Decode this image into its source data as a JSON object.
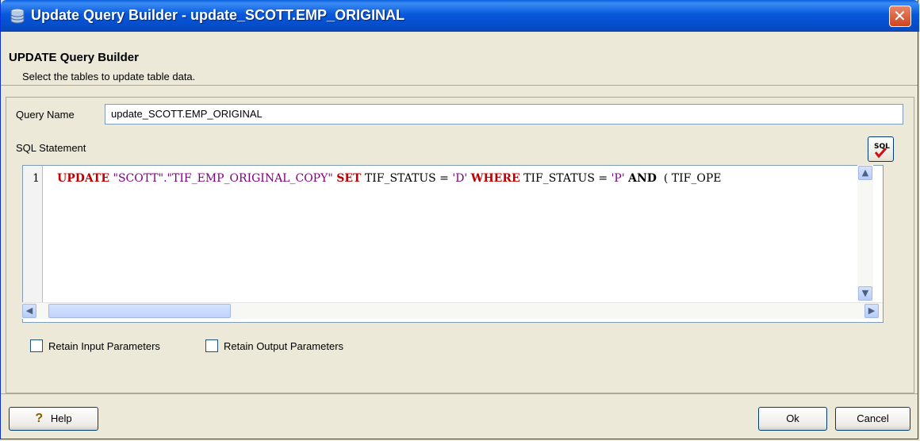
{
  "window": {
    "title": "Update Query Builder - update_SCOTT.EMP_ORIGINAL"
  },
  "header": {
    "title": "UPDATE Query Builder",
    "subtitle": "Select the tables to update table data."
  },
  "form": {
    "query_name_label": "Query Name",
    "query_name_value": "update_SCOTT.EMP_ORIGINAL",
    "sql_label": "SQL Statement",
    "sql_button_label": "SQL"
  },
  "editor": {
    "line_number": "1",
    "tokens": [
      {
        "text": "UPDATE",
        "cls": "kw"
      },
      {
        "text": " ",
        "cls": ""
      },
      {
        "text": "\"SCOTT\".\"TIF_EMP_ORIGINAL_COPY\"",
        "cls": "str"
      },
      {
        "text": " ",
        "cls": ""
      },
      {
        "text": "SET",
        "cls": "kw"
      },
      {
        "text": " TIF_STATUS = ",
        "cls": ""
      },
      {
        "text": "'D'",
        "cls": "str"
      },
      {
        "text": " ",
        "cls": ""
      },
      {
        "text": "WHERE",
        "cls": "kw"
      },
      {
        "text": " TIF_STATUS = ",
        "cls": ""
      },
      {
        "text": "'P'",
        "cls": "str"
      },
      {
        "text": " ",
        "cls": ""
      },
      {
        "text": "AND",
        "cls": "kw2"
      },
      {
        "text": "  ( TIF_OPE",
        "cls": ""
      }
    ]
  },
  "options": {
    "retain_input": {
      "label": "Retain Input Parameters",
      "checked": false
    },
    "retain_output": {
      "label": "Retain Output Parameters",
      "checked": false
    }
  },
  "buttons": {
    "help": "Help",
    "ok": "Ok",
    "cancel": "Cancel"
  },
  "icons": {
    "title": "database-icon",
    "close": "close-icon",
    "sql": "sql-check-icon",
    "help": "question-mark-icon"
  },
  "colors": {
    "keyword": "#c00000",
    "string": "#800080",
    "titlebar": "#0858dc",
    "dialog_bg": "#ece9d8"
  }
}
